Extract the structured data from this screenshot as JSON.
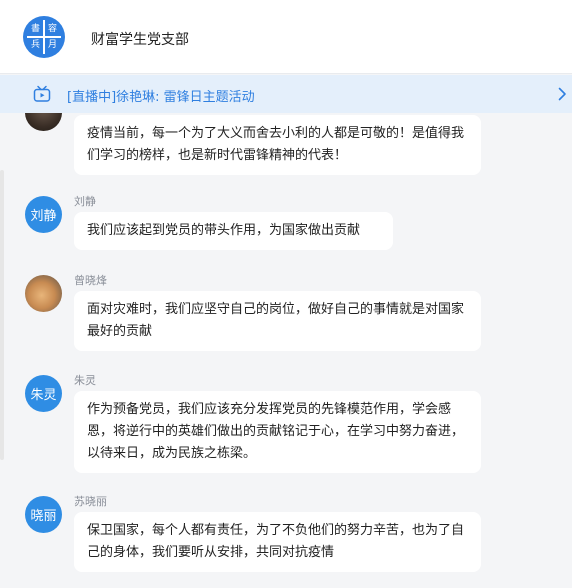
{
  "header": {
    "logo_chars": [
      "書",
      "容",
      "兵",
      "月"
    ],
    "title": "财富学生党支部"
  },
  "live_banner": {
    "text": "[直播中]徐艳琳: 雷锋日主题活动"
  },
  "messages": [
    {
      "sender": "",
      "avatar_text": "",
      "text": "疫情当前，每一个为了大义而舍去小利的人都是可敬的！是值得我们学习的榜样，也是新时代雷锋精神的代表！"
    },
    {
      "sender": "刘静",
      "avatar_text": "刘静",
      "text": "我们应该起到党员的带头作用，为国家做出贡献"
    },
    {
      "sender": "曾晓烽",
      "avatar_text": "",
      "text": "面对灾难时，我们应坚守自己的岗位，做好自己的事情就是对国家最好的贡献"
    },
    {
      "sender": "朱灵",
      "avatar_text": "朱灵",
      "text": "作为预备党员，我们应该充分发挥党员的先锋模范作用，学会感恩，将逆行中的英雄们做出的贡献铭记于心，在学习中努力奋进，以待来日，成为民族之栋梁。"
    },
    {
      "sender": "苏晓丽",
      "avatar_text": "晓丽",
      "text": "保卫国家，每个人都有责任，为了不负他们的努力辛苦，也为了自己的身体，我们要听从安排，共同对抗疫情"
    }
  ],
  "colors": {
    "accent": "#2f7fe0",
    "banner_bg": "#e4effb",
    "page_bg": "#f4f5f7",
    "bubble_bg": "#ffffff"
  },
  "icons": {
    "live": "tv-icon",
    "more": "chevron-right-icon"
  }
}
